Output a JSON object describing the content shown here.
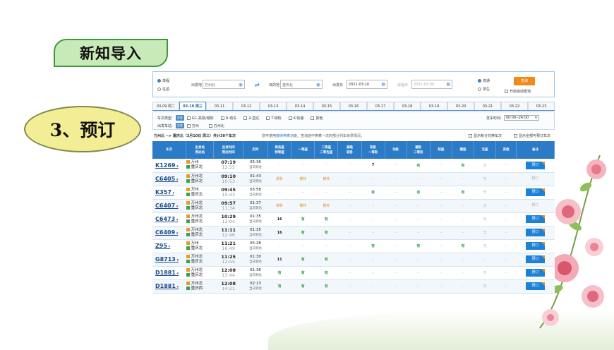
{
  "slide": {
    "title": "新知导入",
    "subtitle": "3、预订"
  },
  "search": {
    "trip_types": [
      "单程",
      "往返"
    ],
    "from_label": "出发地",
    "from_value": "万州北",
    "to_label": "目的地",
    "to_value": "重庆北",
    "depart_label": "出发日",
    "depart_value": "2021-03-10",
    "return_label": "返程日",
    "return_value": "2021-03-09",
    "passenger_types": [
      "普通",
      "学生"
    ],
    "query_label": "查询",
    "auto_query_label": "开启自动查询"
  },
  "date_tabs": [
    "03-09 周二",
    "03-10 周三",
    "03-11",
    "03-12",
    "03-13",
    "03-14",
    "03-15",
    "03-16",
    "03-17",
    "03-18",
    "03-19",
    "03-20",
    "03-21",
    "03-22",
    "03-23"
  ],
  "filters": {
    "type_label": "车次类型:",
    "all_label": "全部",
    "types": [
      "GC-高铁/城际",
      "D-动车",
      "Z-直达",
      "T-特快",
      "K-快速",
      "其他"
    ],
    "station_label": "出发车站:",
    "stations": [
      "万州",
      "万州北"
    ],
    "time_label": "发车时间:",
    "time_value": "00:00--24:00"
  },
  "summary": {
    "route": "万州北 --> 重庆北（3月10日 周三）共计30个车次",
    "tip_pre": "您可使用",
    "tip_link": "接续换乘",
    "tip_post": "功能，查询途中换乘一次的部分列车余票情况。",
    "opt1": "显示积分兑换车次",
    "opt2": "显示全部可预订车次"
  },
  "columns": [
    "车次",
    "出发站\n到达站",
    "出发时间\n到达时间",
    "历时",
    "商务座\n特等座",
    "一等座",
    "二等座\n二等包座",
    "高级\n软卧",
    "软卧\n一等卧",
    "动卧",
    "硬卧\n二等卧",
    "软座",
    "硬座",
    "无座",
    "其他",
    "备注"
  ],
  "book_label": "预订",
  "rows": [
    {
      "train": "K1269",
      "from": "万州",
      "to": "重庆北",
      "dep": "07:19",
      "arr": "12:55",
      "dur": "05:36",
      "day": "当日到达",
      "seats": [
        "--",
        "--",
        "--",
        "--",
        "7",
        "--",
        "有",
        "--",
        "有",
        "无",
        "--"
      ],
      "book": true
    },
    {
      "train": "C6405",
      "from": "万州北",
      "to": "重庆北",
      "dep": "09:10",
      "arr": "10:53",
      "dur": "01:43",
      "day": "当日到达",
      "seats": [
        "候补",
        "候补",
        "候补",
        "--",
        "--",
        "--",
        "--",
        "--",
        "--",
        "无",
        "--"
      ],
      "book": false
    },
    {
      "train": "K357",
      "from": "万州",
      "to": "重庆北",
      "dep": "09:45",
      "arr": "15:43",
      "dur": "05:58",
      "day": "当日到达",
      "seats": [
        "--",
        "--",
        "--",
        "--",
        "有",
        "--",
        "有",
        "--",
        "有",
        "无",
        "--"
      ],
      "book": true
    },
    {
      "train": "C6407",
      "from": "万州北",
      "to": "重庆北",
      "dep": "09:57",
      "arr": "11:34",
      "dur": "01:37",
      "day": "当日到达",
      "seats": [
        "候补",
        "候补",
        "候补",
        "--",
        "--",
        "--",
        "--",
        "--",
        "--",
        "无",
        "--"
      ],
      "book": false
    },
    {
      "train": "C6473",
      "from": "万州北",
      "to": "重庆北",
      "dep": "10:29",
      "arr": "12:04",
      "dur": "01:35",
      "day": "当日到达",
      "seats": [
        "16",
        "有",
        "有",
        "--",
        "--",
        "--",
        "--",
        "--",
        "--",
        "无",
        "--"
      ],
      "book": true
    },
    {
      "train": "C6409",
      "from": "万州北",
      "to": "重庆北",
      "dep": "11:11",
      "arr": "12:46",
      "dur": "01:35",
      "day": "当日到达",
      "seats": [
        "16",
        "有",
        "有",
        "--",
        "--",
        "--",
        "--",
        "--",
        "--",
        "无",
        "--"
      ],
      "book": true
    },
    {
      "train": "Z95",
      "from": "万州",
      "to": "重庆北",
      "dep": "11:21",
      "arr": "16:49",
      "dur": "05:28",
      "day": "当日到达",
      "seats": [
        "--",
        "--",
        "--",
        "--",
        "有",
        "--",
        "有",
        "--",
        "有",
        "无",
        "--"
      ],
      "book": true
    },
    {
      "train": "G8713",
      "from": "万州北",
      "to": "重庆北",
      "dep": "11:25",
      "arr": "12:55",
      "dur": "01:30",
      "day": "当日到达",
      "seats": [
        "11",
        "有",
        "有",
        "--",
        "--",
        "--",
        "--",
        "--",
        "--",
        "--",
        "--"
      ],
      "book": true
    },
    {
      "train": "D1881",
      "from": "万州北",
      "to": "重庆北",
      "dep": "12:08",
      "arr": "13:44",
      "dur": "01:36",
      "day": "当日到达",
      "seats": [
        "有",
        "有",
        "有",
        "--",
        "--",
        "--",
        "--",
        "--",
        "--",
        "无",
        "--"
      ],
      "book": true
    },
    {
      "train": "D1881",
      "from": "万州北",
      "to": "重庆西",
      "dep": "12:08",
      "arr": "14:21",
      "dur": "02:13",
      "day": "当日到达",
      "seats": [
        "有",
        "有",
        "有",
        "--",
        "--",
        "--",
        "--",
        "--",
        "--",
        "无",
        "--"
      ],
      "book": true
    }
  ]
}
